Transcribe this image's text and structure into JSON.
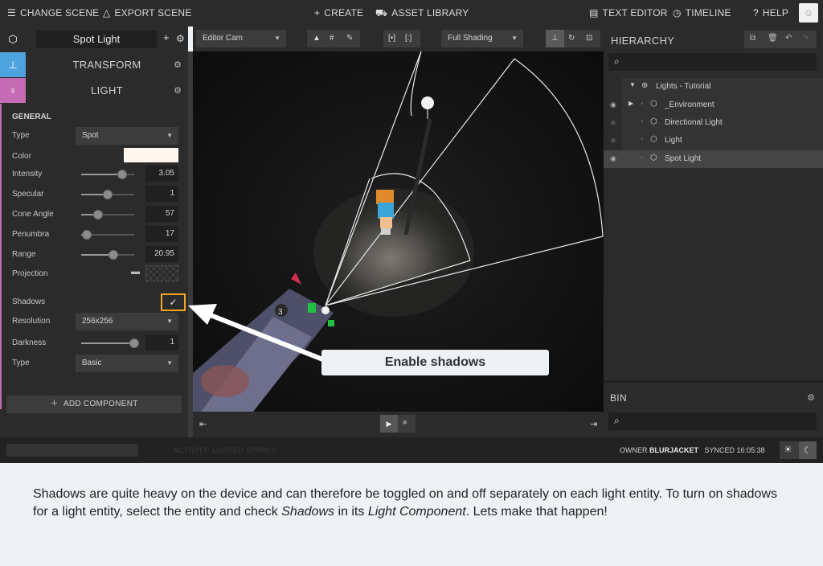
{
  "topbar": {
    "change_scene": "CHANGE SCENE",
    "export_scene": "EXPORT SCENE",
    "create": "CREATE",
    "asset_library": "ASSET LIBRARY",
    "text_editor": "TEXT EDITOR",
    "timeline": "TIMELINE",
    "help": "HELP"
  },
  "inspector": {
    "entity_name": "Spot Light",
    "transform_title": "TRANSFORM",
    "light_title": "LIGHT",
    "general_label": "GENERAL",
    "type_label": "Type",
    "type_value": "Spot",
    "color_label": "Color",
    "color_value": "#fff6ef",
    "intensity_label": "Intensity",
    "intensity_value": "3.05",
    "intensity_fraction": 0.78,
    "specular_label": "Specular",
    "specular_value": "1",
    "specular_fraction": 0.5,
    "cone_angle_label": "Cone Angle",
    "cone_angle_value": "57",
    "cone_angle_fraction": 0.32,
    "penumbra_label": "Penumbra",
    "penumbra_value": "17",
    "penumbra_fraction": 0.1,
    "range_label": "Range",
    "range_value": "20.95",
    "range_fraction": 0.6,
    "projection_label": "Projection",
    "shadows_label": "Shadows",
    "shadows_checked": true,
    "resolution_label": "Resolution",
    "resolution_value": "256x256",
    "darkness_label": "Darkness",
    "darkness_value": "1",
    "darkness_fraction": 1.0,
    "shadow_type_label": "Type",
    "shadow_type_value": "Basic",
    "add_component": "ADD COMPONENT"
  },
  "viewport": {
    "camera": "Editor Cam",
    "shading": "Full Shading"
  },
  "hierarchy": {
    "title": "HIERARCHY",
    "items": [
      {
        "label": "Lights - Tutorial"
      },
      {
        "label": "_Environment"
      },
      {
        "label": "Directional Light"
      },
      {
        "label": "Light"
      },
      {
        "label": "Spot Light"
      }
    ]
  },
  "bin": {
    "title": "BIN"
  },
  "status": {
    "activity": "ACTIVITY: LOADED SPARKS",
    "owner_label": "OWNER",
    "owner_name": "BLURJACKET",
    "synced": "SYNCED 16:05:38"
  },
  "callout": "Enable shadows",
  "caption": {
    "part1": "Shadows are quite heavy on the device and can therefore be toggled on and off separately on each light entity. To turn on shadows for a light entity, select the entity and check ",
    "em1": "Shadows",
    "part2": " in its ",
    "em2": "Light Component",
    "part3": ". Lets make that happen!"
  },
  "colors": {
    "accent_shadow_highlight": "#f5a623",
    "transform_tab": "#4da3dd",
    "light_tab": "#c56bb3"
  }
}
